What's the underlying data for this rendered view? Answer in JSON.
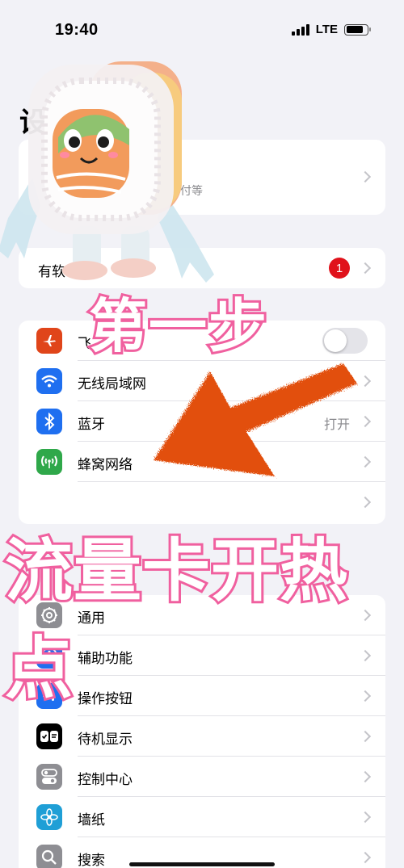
{
  "status_bar": {
    "time": "19:40",
    "network": "LTE",
    "battery_level": 0.8
  },
  "page_title": "设",
  "profile": {
    "subtitle": "付等"
  },
  "update_row": {
    "label": "有软",
    "badge_count": "1"
  },
  "network_section": {
    "rows": [
      {
        "label": "飞",
        "icon": "airplane-icon",
        "color": "#e0451a",
        "toggle": false
      },
      {
        "label": "无线局域网",
        "icon": "wifi-icon",
        "color": "#1f6ff0",
        "value": ""
      },
      {
        "label": "蓝牙",
        "icon": "bluetooth-icon",
        "color": "#1f6ff0",
        "value": "打开"
      },
      {
        "label": "蜂窝网络",
        "icon": "cellular-icon",
        "color": "#2fa84a",
        "value": ""
      },
      {
        "label": "",
        "icon": "blank-icon",
        "color": "#ffffff",
        "value": ""
      }
    ]
  },
  "general_section": {
    "rows": [
      {
        "label": "通用",
        "icon": "gear-icon",
        "color": "#8e8e93"
      },
      {
        "label": "辅助功能",
        "icon": "accessibility-icon",
        "color": "#1f6ff0"
      },
      {
        "label": "操作按钮",
        "icon": "action-button-icon",
        "color": "#1f6ff0"
      },
      {
        "label": "待机显示",
        "icon": "standby-icon",
        "color": "#000000"
      },
      {
        "label": "控制中心",
        "icon": "control-center-icon",
        "color": "#8e8e93"
      },
      {
        "label": "墙纸",
        "icon": "wallpaper-icon",
        "color": "#1f9fd6"
      },
      {
        "label": "搜索",
        "icon": "search-icon",
        "color": "#8e8e93"
      }
    ]
  },
  "overlay": {
    "step": "第一步",
    "caption": "流量卡开热点"
  },
  "colors": {
    "accent_pink": "#f0609f",
    "arrow_orange": "#e24f0e",
    "badge_red": "#e0121b"
  }
}
